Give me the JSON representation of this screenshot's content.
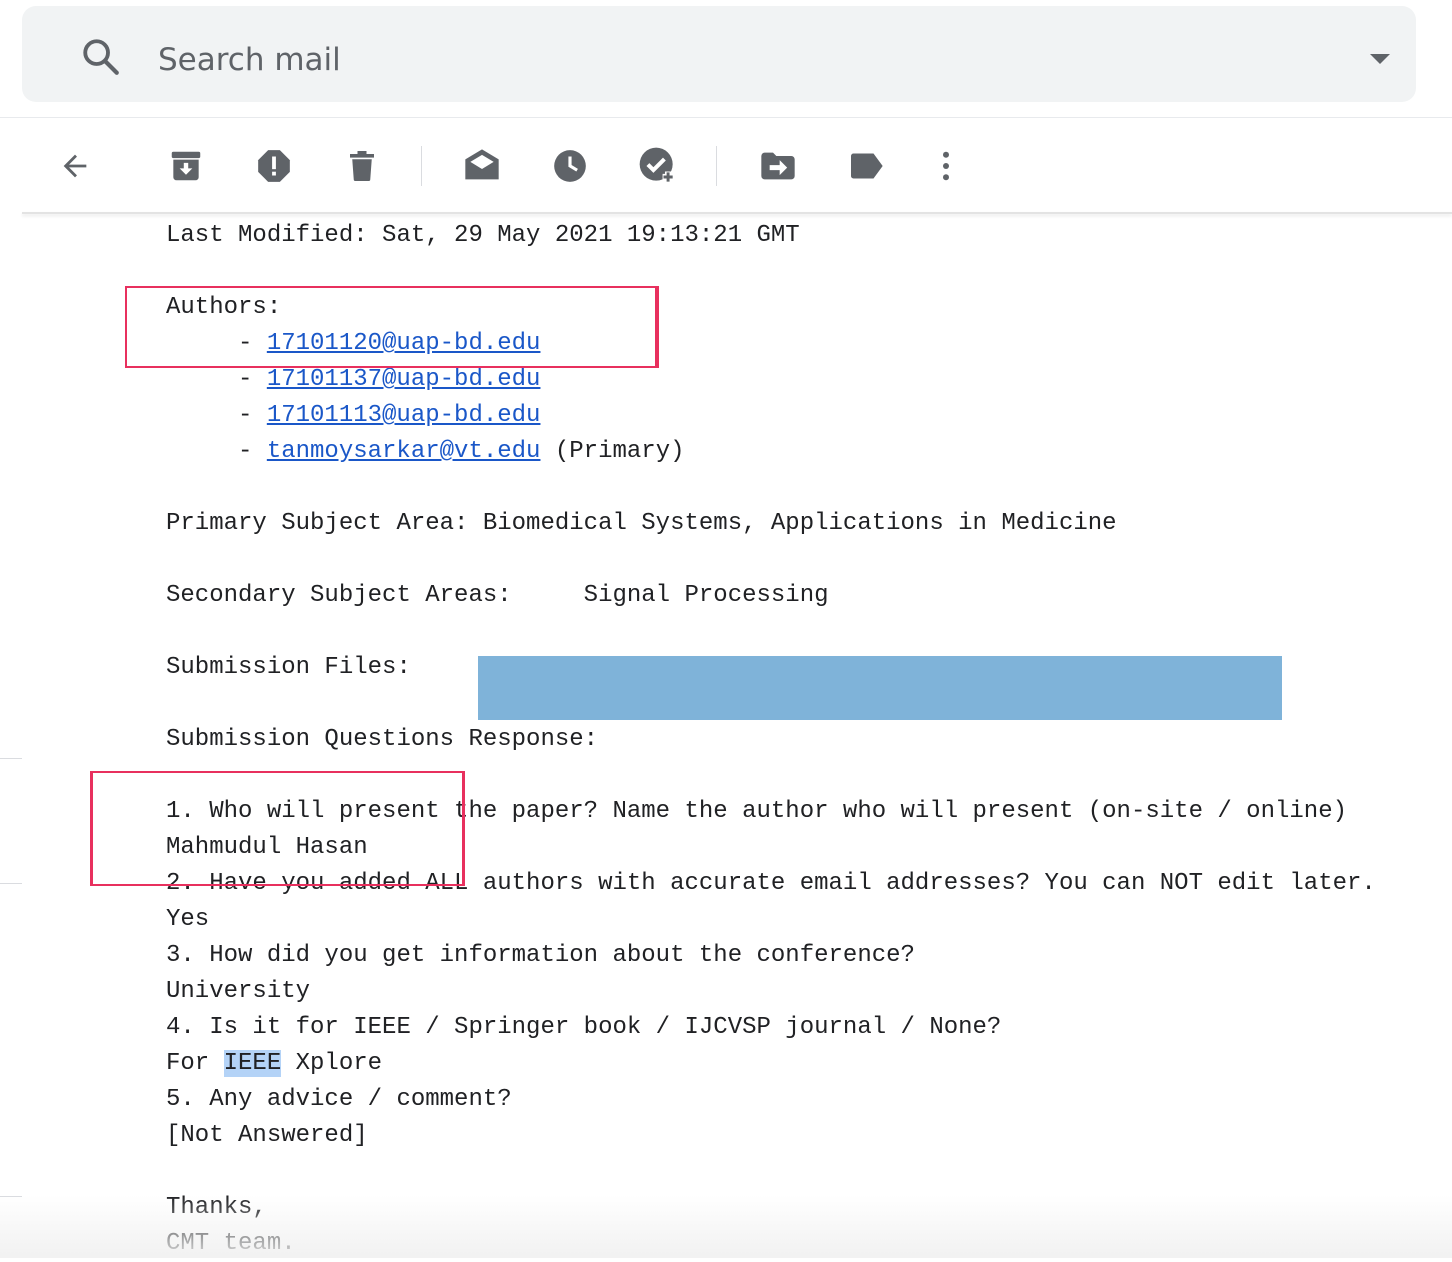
{
  "search": {
    "placeholder": "Search mail",
    "search_icon": "search-icon",
    "dropdown_icon": "chevron-down-icon"
  },
  "toolbar": {
    "buttons": [
      {
        "name": "back",
        "icon": "arrow-back-icon"
      },
      {
        "name": "archive",
        "icon": "archive-icon"
      },
      {
        "name": "report-spam",
        "icon": "report-spam-icon"
      },
      {
        "name": "delete",
        "icon": "trash-icon"
      },
      {
        "name": "mark-unread",
        "icon": "mark-unread-icon"
      },
      {
        "name": "snooze",
        "icon": "clock-icon"
      },
      {
        "name": "add-to-tasks",
        "icon": "add-task-icon"
      },
      {
        "name": "move-to",
        "icon": "move-to-icon"
      },
      {
        "name": "labels",
        "icon": "label-icon"
      },
      {
        "name": "more",
        "icon": "more-vert-icon"
      }
    ]
  },
  "email": {
    "last_modified": "Last Modified: Sat, 29 May 2021 19:13:21 GMT",
    "authors_heading": "Authors:",
    "authors": [
      {
        "email": "17101120@uap-bd.edu",
        "note": ""
      },
      {
        "email": "17101137@uap-bd.edu",
        "note": ""
      },
      {
        "email": "17101113@uap-bd.edu",
        "note": ""
      },
      {
        "email": "tanmoysarkar@vt.edu",
        "note": " (Primary)"
      }
    ],
    "primary_subject_area": "Primary Subject Area: Biomedical Systems, Applications in Medicine",
    "secondary_subject_areas": "Secondary Subject Areas:     Signal Processing",
    "submission_files": "Submission Files:",
    "questions_heading": "Submission Questions Response:",
    "qa": [
      {
        "q": "1. Who will present the paper? Name the author who will present (on-site / online)",
        "a": "Mahmudul Hasan"
      },
      {
        "q": "2. Have you added ALL authors with accurate email addresses? You can NOT edit later.",
        "a": "Yes"
      },
      {
        "q": "3. How did you get information about the conference?",
        "a": "University"
      },
      {
        "q": "4. Is it for IEEE / Springer book / IJCVSP journal / None?",
        "a_prefix": "For ",
        "a_highlight": "IEEE",
        "a_suffix": " Xplore"
      },
      {
        "q": "5. Any advice / comment?",
        "a": "[Not Answered]"
      }
    ],
    "signoff": "Thanks,",
    "signature": "CMT team."
  },
  "colors": {
    "link": "#1a57c8",
    "annotation_border": "#e8305e",
    "redaction": "#7fb3d9",
    "selection_highlight": "#b4d3f7"
  }
}
